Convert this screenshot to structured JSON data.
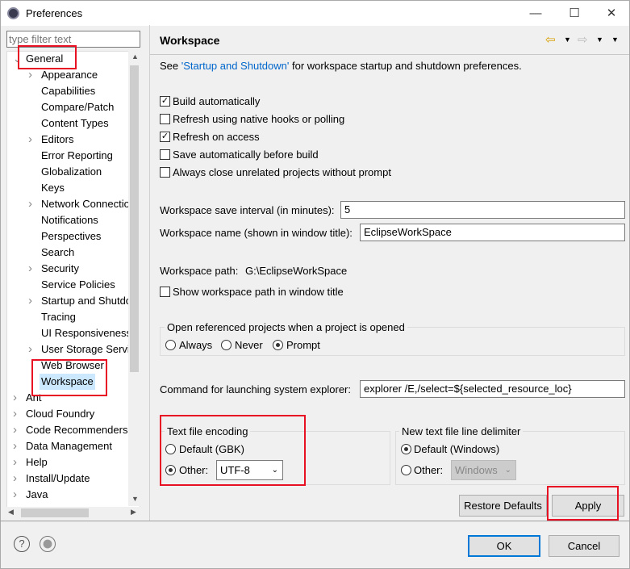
{
  "window": {
    "title": "Preferences",
    "icon": "eclipse-gear-icon"
  },
  "filter": {
    "placeholder": "type filter text"
  },
  "tree": [
    {
      "label": "General",
      "level": 0,
      "expanded": true
    },
    {
      "label": "Appearance",
      "level": 1,
      "expandable": true
    },
    {
      "label": "Capabilities",
      "level": 1
    },
    {
      "label": "Compare/Patch",
      "level": 1
    },
    {
      "label": "Content Types",
      "level": 1
    },
    {
      "label": "Editors",
      "level": 1,
      "expandable": true
    },
    {
      "label": "Error Reporting",
      "level": 1
    },
    {
      "label": "Globalization",
      "level": 1
    },
    {
      "label": "Keys",
      "level": 1
    },
    {
      "label": "Network Connections",
      "level": 1,
      "expandable": true
    },
    {
      "label": "Notifications",
      "level": 1
    },
    {
      "label": "Perspectives",
      "level": 1
    },
    {
      "label": "Search",
      "level": 1
    },
    {
      "label": "Security",
      "level": 1,
      "expandable": true
    },
    {
      "label": "Service Policies",
      "level": 1
    },
    {
      "label": "Startup and Shutdown",
      "level": 1,
      "expandable": true
    },
    {
      "label": "Tracing",
      "level": 1
    },
    {
      "label": "UI Responsiveness",
      "level": 1
    },
    {
      "label": "User Storage Service",
      "level": 1,
      "expandable": true
    },
    {
      "label": "Web Browser",
      "level": 1
    },
    {
      "label": "Workspace",
      "level": 1,
      "selected": true
    },
    {
      "label": "Ant",
      "level": 0,
      "expandable": true
    },
    {
      "label": "Cloud Foundry",
      "level": 0,
      "expandable": true
    },
    {
      "label": "Code Recommenders",
      "level": 0,
      "expandable": true
    },
    {
      "label": "Data Management",
      "level": 0,
      "expandable": true
    },
    {
      "label": "Help",
      "level": 0,
      "expandable": true
    },
    {
      "label": "Install/Update",
      "level": 0,
      "expandable": true
    },
    {
      "label": "Java",
      "level": 0,
      "expandable": true
    }
  ],
  "page": {
    "title": "Workspace",
    "see_prefix": "See ",
    "see_link": "'Startup and Shutdown'",
    "see_suffix": " for workspace startup and shutdown preferences.",
    "checks": [
      {
        "label": "Build automatically",
        "checked": true
      },
      {
        "label": "Refresh using native hooks or polling",
        "checked": false
      },
      {
        "label": "Refresh on access",
        "checked": true
      },
      {
        "label": "Save automatically before build",
        "checked": false
      },
      {
        "label": "Always close unrelated projects without prompt",
        "checked": false
      }
    ],
    "save_interval_label": "Workspace save interval (in minutes):",
    "save_interval_value": "5",
    "ws_name_label": "Workspace name (shown in window title):",
    "ws_name_value": "EclipseWorkSpace",
    "ws_path_label": "Workspace path:",
    "ws_path_value": "G:\\EclipseWorkSpace",
    "show_path_label": "Show workspace path in window title",
    "open_ref_title": "Open referenced projects when a project is opened",
    "open_ref_options": [
      "Always",
      "Never",
      "Prompt"
    ],
    "open_ref_selected": "Prompt",
    "cmd_label": "Command for launching system explorer:",
    "cmd_value": "explorer /E,/select=${selected_resource_loc}",
    "encoding": {
      "title": "Text file encoding",
      "default_label": "Default (GBK)",
      "other_label": "Other:",
      "other_value": "UTF-8",
      "selected": "Other"
    },
    "delimiter": {
      "title": "New text file line delimiter",
      "default_label": "Default (Windows)",
      "other_label": "Other:",
      "other_value": "Windows",
      "selected": "Default"
    },
    "restore_label": "Restore Defaults",
    "apply_label": "Apply"
  },
  "footer": {
    "ok_label": "OK",
    "cancel_label": "Cancel"
  },
  "colors": {
    "highlight": "#e81123",
    "selection": "#cce8ff",
    "link": "#0066cc",
    "ok_border": "#0078d7"
  }
}
